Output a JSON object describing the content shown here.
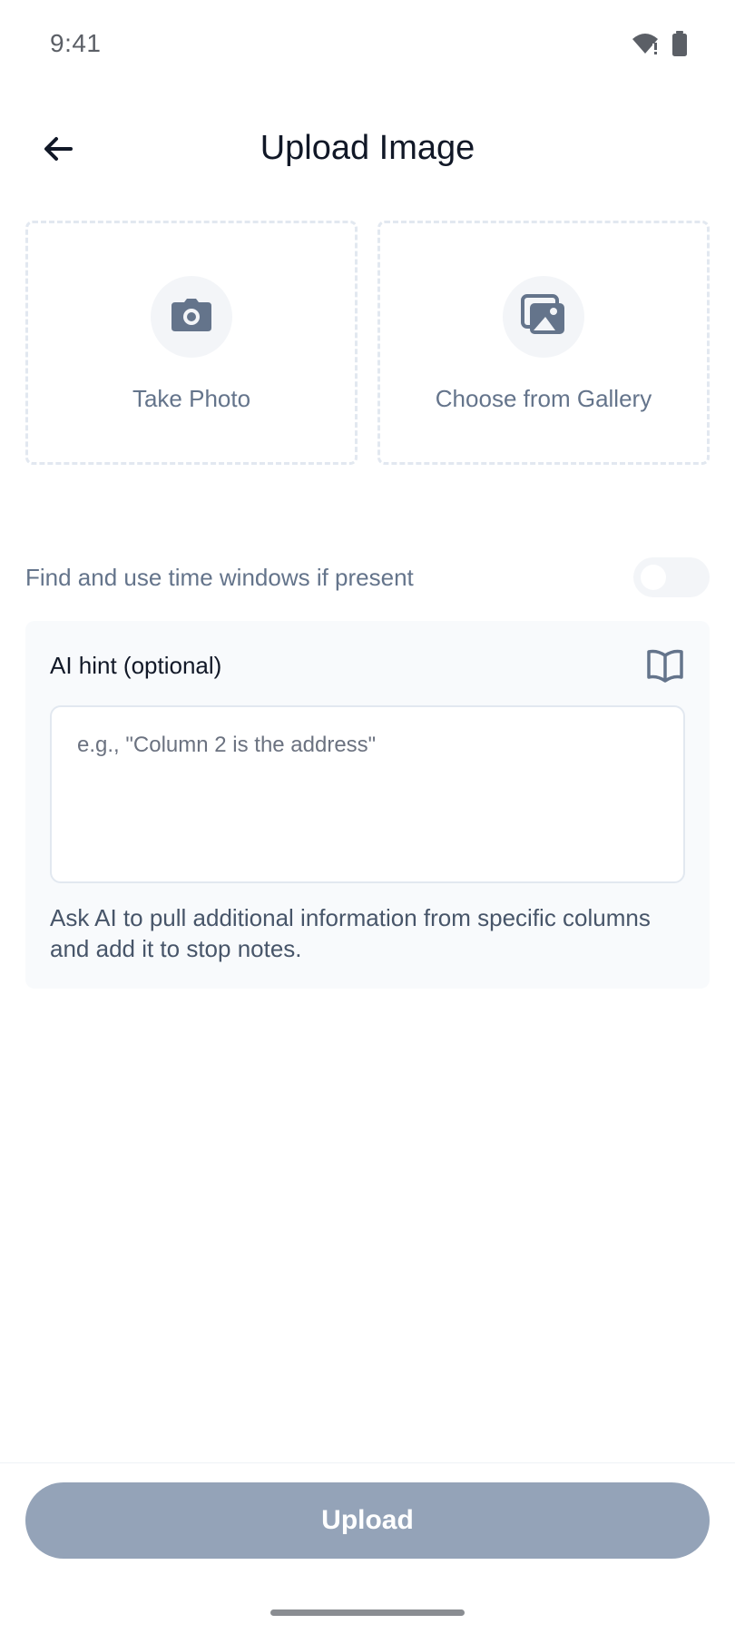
{
  "status_bar": {
    "time": "9:41",
    "icons": [
      "wifi-icon",
      "battery-icon"
    ]
  },
  "header": {
    "back_icon": "arrow-left-icon",
    "title": "Upload Image"
  },
  "sources": [
    {
      "label": "Take Photo",
      "icon": "camera-icon"
    },
    {
      "label": "Choose from Gallery",
      "icon": "gallery-icon"
    }
  ],
  "time_windows": {
    "label": "Find and use time windows if present",
    "enabled": false
  },
  "ai_hint": {
    "title": "AI hint (optional)",
    "icon": "book-icon",
    "placeholder": "e.g., \"Column 2 is the address\"",
    "value": "",
    "help_text": "Ask AI to pull additional information from specific columns and add it to stop notes."
  },
  "footer": {
    "upload_label": "Upload",
    "enabled": false
  },
  "colors": {
    "accent_disabled": "#94a3b8",
    "muted_text": "#64748b",
    "card_bg": "#f8fafc",
    "dashed_border": "#e2e8f0"
  }
}
